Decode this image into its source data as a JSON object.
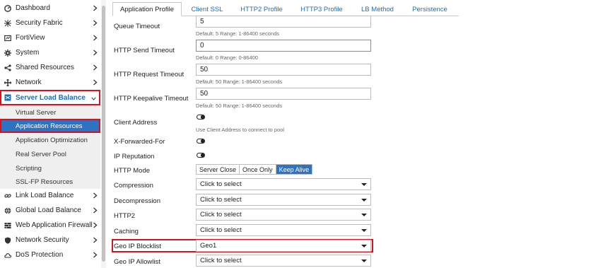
{
  "sidebar": {
    "items": [
      {
        "label": "Dashboard",
        "icon": "dashboard-icon"
      },
      {
        "label": "Security Fabric",
        "icon": "security-fabric-icon"
      },
      {
        "label": "FortiView",
        "icon": "fortiview-icon"
      },
      {
        "label": "System",
        "icon": "gear-icon"
      },
      {
        "label": "Shared Resources",
        "icon": "share-icon"
      },
      {
        "label": "Network",
        "icon": "network-icon"
      },
      {
        "label": "Server Load Balance",
        "icon": "server-load-balance-icon"
      },
      {
        "label": "Link Load Balance",
        "icon": "link-icon"
      },
      {
        "label": "Global Load Balance",
        "icon": "globe-icon"
      },
      {
        "label": "Web Application Firewall",
        "icon": "firewall-icon"
      },
      {
        "label": "Network Security",
        "icon": "shield-icon"
      },
      {
        "label": "DoS Protection",
        "icon": "cloud-icon"
      }
    ],
    "subitems": [
      "Virtual Server",
      "Application Resources",
      "Application Optimization",
      "Real Server Pool",
      "Scripting",
      "SSL-FP Resources"
    ]
  },
  "tabs": [
    "Application Profile",
    "Client SSL",
    "HTTP2 Profile",
    "HTTP3 Profile",
    "LB Method",
    "Persistence"
  ],
  "form": {
    "queue_timeout": {
      "label": "Queue Timeout",
      "value": "5",
      "hint": "Default: 5 Range: 1-86400 seconds"
    },
    "http_send_timeout": {
      "label": "HTTP Send Timeout",
      "value": "0",
      "hint": "Default: 0 Range: 0-86400"
    },
    "http_request_timeout": {
      "label": "HTTP Request Timeout",
      "value": "50",
      "hint": "Default: 50 Range: 1-86400 seconds"
    },
    "http_keepalive_timeout": {
      "label": "HTTP Keepalive Timeout",
      "value": "50",
      "hint": "Default: 50 Range: 1-86400 seconds"
    },
    "client_address": {
      "label": "Client Address",
      "hint": "Use Client Address to connect to pool"
    },
    "x_forwarded_for": {
      "label": "X-Forwarded-For"
    },
    "ip_reputation": {
      "label": "IP Reputation"
    },
    "http_mode": {
      "label": "HTTP Mode",
      "options": [
        "Server Close",
        "Once Only",
        "Keep Alive"
      ],
      "selected": "Keep Alive"
    },
    "compression": {
      "label": "Compression",
      "value": "Click to select"
    },
    "decompression": {
      "label": "Decompression",
      "value": "Click to select"
    },
    "http2": {
      "label": "HTTP2",
      "value": "Click to select"
    },
    "caching": {
      "label": "Caching",
      "value": "Click to select"
    },
    "geo_ip_blocklist": {
      "label": "Geo IP Blocklist",
      "value": "Geo1"
    },
    "geo_ip_allowlist": {
      "label": "Geo IP Allowlist",
      "value": "Click to select"
    }
  },
  "colors": {
    "accent": "#2f72c2",
    "highlight": "#d9121f",
    "link": "#1f6fb2"
  }
}
